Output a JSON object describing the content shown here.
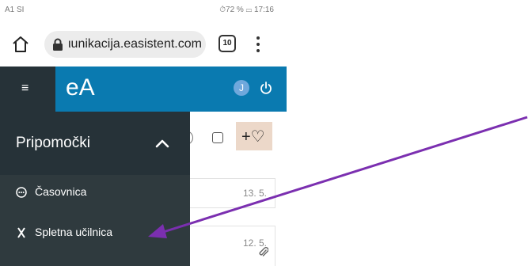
{
  "status_bar": {
    "carrier": "A1 SI",
    "right": "⏱72 % ▭ 17:16"
  },
  "browser": {
    "url": "ιunikacija.easistent.com",
    "tab_count": "10"
  },
  "app": {
    "logo": "eA",
    "avatar_letter": "J"
  },
  "content": {
    "add_label": "+♡",
    "rows": [
      {
        "date": "13. 5."
      },
      {
        "date": "12. 5."
      }
    ]
  },
  "drawer": {
    "title": "Pripomočki",
    "items": [
      {
        "label": "Časovnica",
        "icon": "dots-circle-icon"
      },
      {
        "label": "Spletna učilnica",
        "icon": "x-icon"
      }
    ]
  },
  "colors": {
    "header_blue": "#0a7ab0",
    "drawer_dark": "#263238",
    "drawer_body": "#2f3a3e",
    "annotation_arrow": "#7b2fb0",
    "add_chip": "#ecd8c9"
  }
}
